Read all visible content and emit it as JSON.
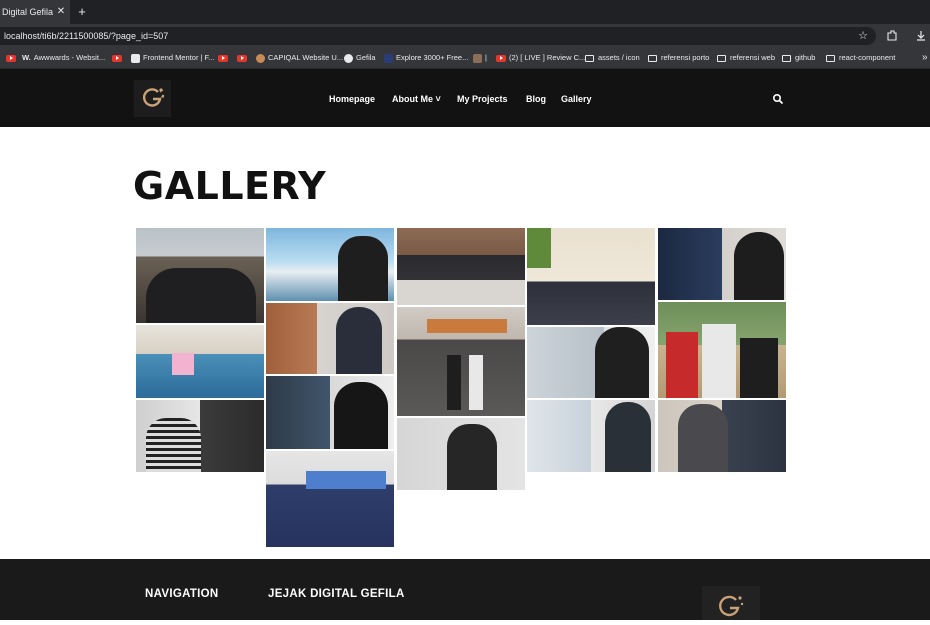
{
  "browser": {
    "tab_title": "Digital Gefila",
    "close_glyph": "✕",
    "newtab_glyph": "+",
    "url": "localhost/ti6b/2211500085/?page_id=507",
    "star_glyph": "☆",
    "bookmarks": [
      {
        "label": "",
        "icon": "youtube-icon"
      },
      {
        "label": "Awwwards - Websit...",
        "icon": "awwwards-icon"
      },
      {
        "label": "",
        "icon": "youtube-icon"
      },
      {
        "label": "Frontend Mentor | F...",
        "icon": "frontend-mentor-icon"
      },
      {
        "label": "",
        "icon": "youtube-icon"
      },
      {
        "label": "",
        "icon": "youtube-icon"
      },
      {
        "label": "CAPIQAL Website U...",
        "icon": "capiqal-icon"
      },
      {
        "label": "Gefila",
        "icon": "github-icon"
      },
      {
        "label": "Explore 3000+ Free...",
        "icon": "ui-icon"
      },
      {
        "label": "|",
        "icon": "photo-icon"
      },
      {
        "label": "(2) [ LIVE ] Review C...",
        "icon": "youtube-icon"
      },
      {
        "label": "assets / icon",
        "icon": "folder-icon"
      },
      {
        "label": "referensi porto",
        "icon": "folder-icon"
      },
      {
        "label": "referensi web",
        "icon": "folder-icon"
      },
      {
        "label": "github",
        "icon": "folder-icon"
      },
      {
        "label": "react-component",
        "icon": "folder-icon"
      }
    ],
    "more_glyph": "»"
  },
  "site": {
    "nav": [
      {
        "label": "Homepage"
      },
      {
        "label": "About Me ˅"
      },
      {
        "label": "My Projects"
      },
      {
        "label": "Blog"
      },
      {
        "label": "Gallery"
      }
    ],
    "page_title": "GALLERY",
    "footer": {
      "nav_heading": "NAVIGATION",
      "brand_heading": "JEJAK DIGITAL GEFILA"
    }
  },
  "colors": {
    "header_bg": "#121212",
    "footer_bg": "#1a1a1a",
    "logo_gold": "#c9a27a"
  }
}
